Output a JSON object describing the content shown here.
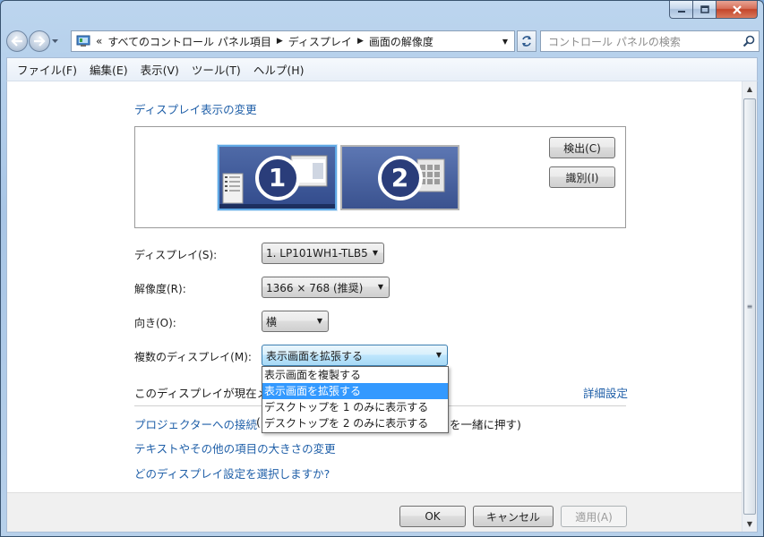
{
  "window": {
    "caption_buttons": [
      "minimize",
      "maximize",
      "close"
    ]
  },
  "address": {
    "overflow": "«",
    "crumbs": [
      "すべてのコントロール パネル項目",
      "ディスプレイ",
      "画面の解像度"
    ],
    "search_placeholder": "コントロール パネルの検索"
  },
  "menu": [
    "ファイル(F)",
    "編集(E)",
    "表示(V)",
    "ツール(T)",
    "ヘルプ(H)"
  ],
  "main": {
    "heading": "ディスプレイ表示の変更",
    "monitors": [
      {
        "number": "1",
        "selected": true
      },
      {
        "number": "2",
        "selected": false
      }
    ],
    "detect_label": "検出(C)",
    "identify_label": "識別(I)",
    "display_label": "ディスプレイ(S):",
    "display_value": "1. LP101WH1-TLB5",
    "resolution_label": "解像度(R):",
    "resolution_value": "1366 × 768 (推奨)",
    "orientation_label": "向き(O):",
    "orientation_value": "横",
    "multi_label": "複数のディスプレイ(M):",
    "multi_value": "表示画面を拡張する",
    "multi_options": [
      "表示画面を複製する",
      "表示画面を拡張する",
      "デスクトップを 1 のみに表示する",
      "デスクトップを 2 のみに表示する"
    ],
    "multi_selected_index": 1,
    "main_display_text": "このディスプレイが現在メ",
    "advanced_link": "詳細設定",
    "projector_link": "プロジェクターへの接続",
    "projector_suffix": "(",
    "projector_shortcut_tail": "を一緒に押す)",
    "text_size_link": "テキストやその他の項目の大きさの変更",
    "which_settings_link": "どのディスプレイ設定を選択しますか?"
  },
  "footer": {
    "ok": "OK",
    "cancel": "キャンセル",
    "apply": "適用(A)"
  },
  "colors": {
    "link": "#1f5fa8",
    "selection": "#3399ff",
    "frame": "#a9c6e6"
  },
  "icons": {
    "back": "arrow-left-icon",
    "forward": "arrow-right-icon",
    "refresh": "refresh-icon",
    "search": "magnifier-icon",
    "address": "control-panel-icon"
  }
}
